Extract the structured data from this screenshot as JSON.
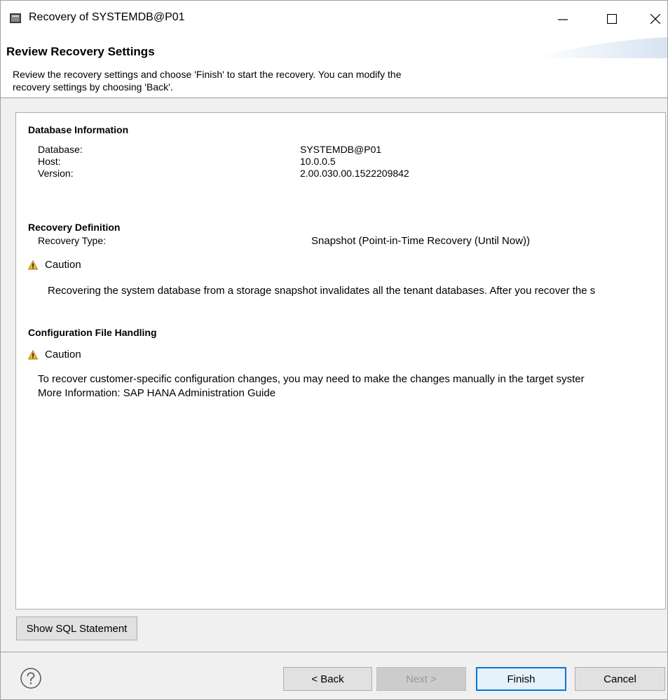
{
  "window": {
    "title": "Recovery of SYSTEMDB@P01"
  },
  "banner": {
    "title": "Review Recovery Settings",
    "description_line1": "Review the recovery settings and choose 'Finish' to start the recovery. You can modify the",
    "description_line2": "recovery settings by choosing 'Back'."
  },
  "database_info": {
    "title": "Database Information",
    "rows": [
      {
        "label": "Database:",
        "value": "SYSTEMDB@P01"
      },
      {
        "label": "Host:",
        "value": "10.0.0.5"
      },
      {
        "label": "Version:",
        "value": "2.00.030.00.1522209842"
      }
    ]
  },
  "recovery_definition": {
    "title": "Recovery Definition",
    "type_label": "Recovery Type:",
    "type_value": "Snapshot (Point-in-Time Recovery (Until Now))",
    "caution_label": "Caution",
    "caution_text": "Recovering the system database from a storage snapshot invalidates all the tenant databases. After you recover the s"
  },
  "config_handling": {
    "title": "Configuration File Handling",
    "caution_label": "Caution",
    "text_line1": "To recover customer-specific configuration changes, you may need to make the changes manually in the target syster",
    "text_line2": "More Information: SAP HANA Administration Guide"
  },
  "buttons": {
    "show_sql": "Show SQL Statement",
    "back": "< Back",
    "next": "Next >",
    "finish": "Finish",
    "cancel": "Cancel"
  },
  "colors": {
    "accent": "#0078d7",
    "warning": "#e8a317"
  }
}
